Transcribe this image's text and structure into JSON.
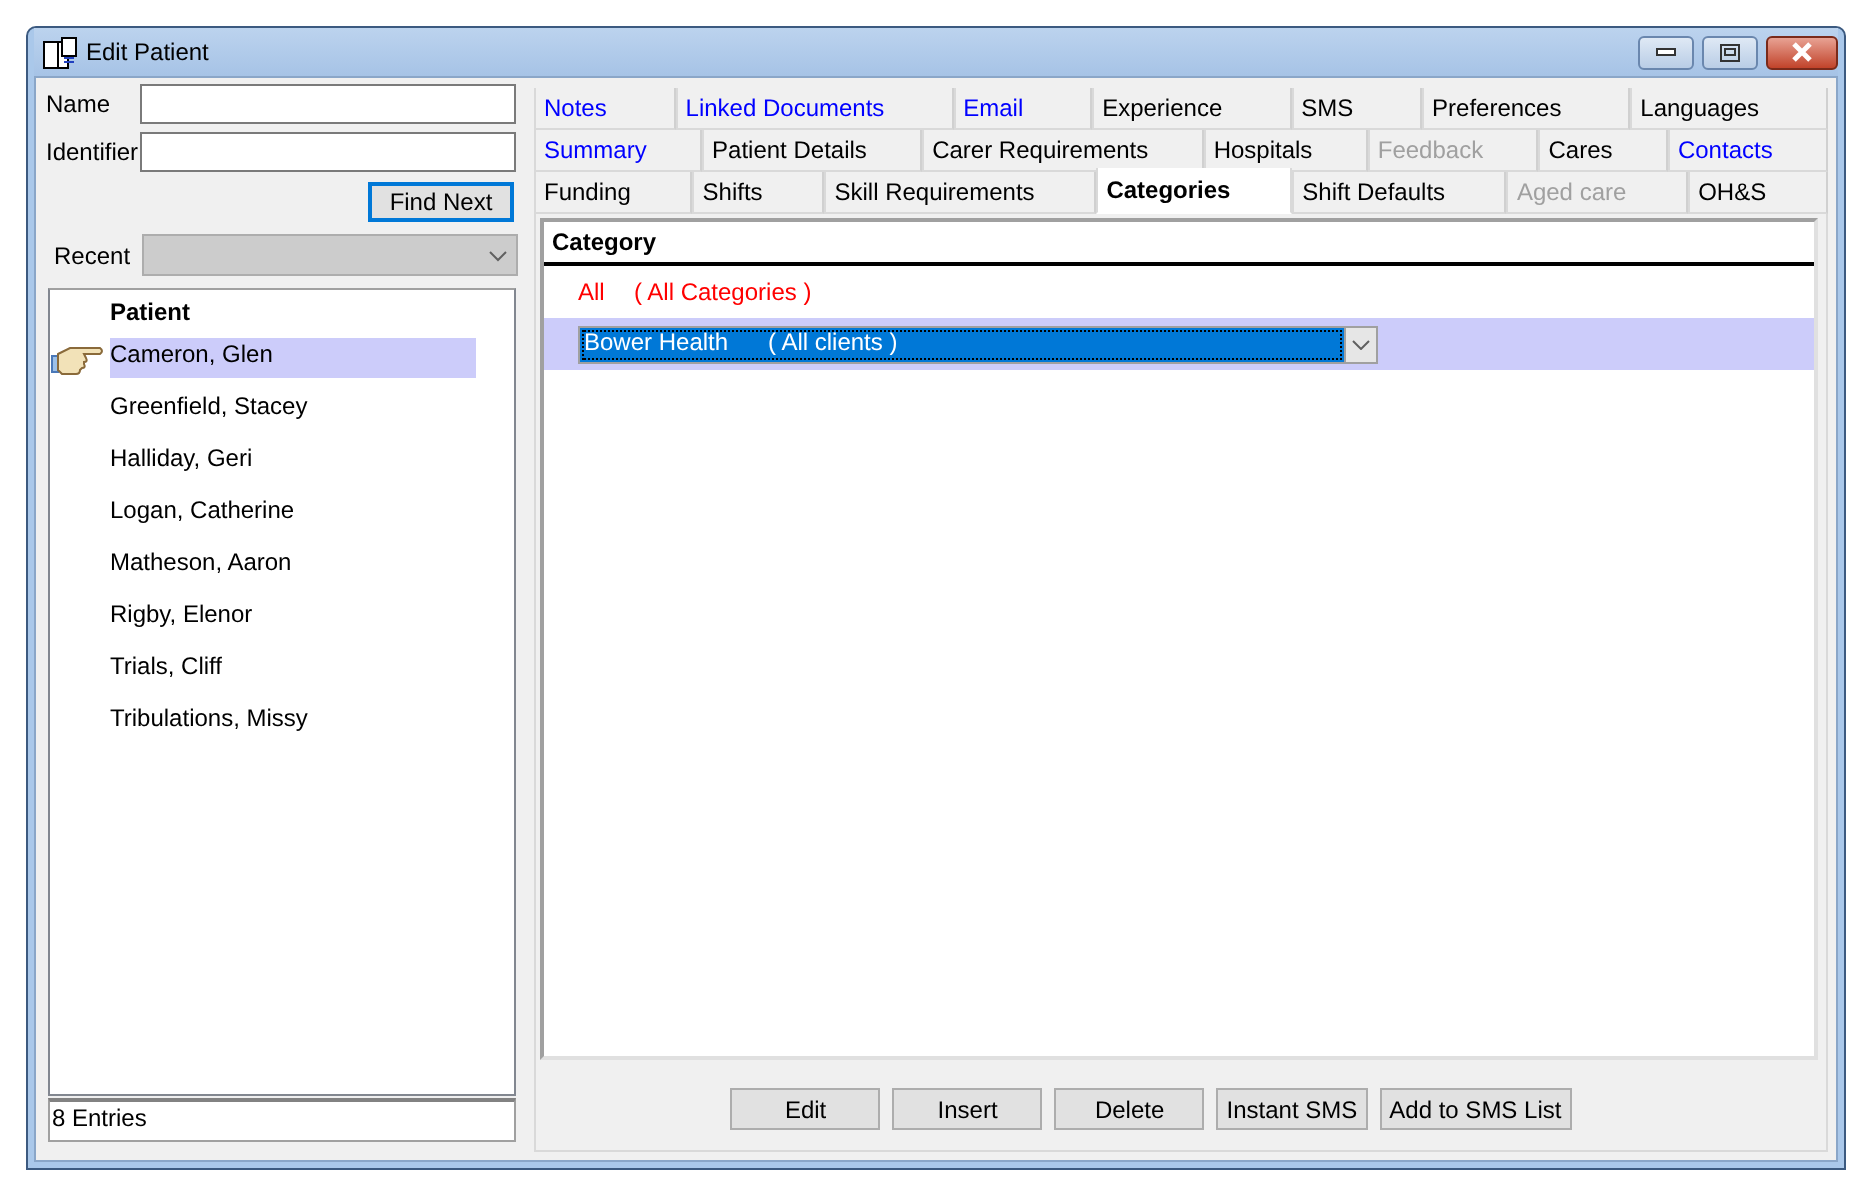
{
  "window": {
    "title": "Edit Patient"
  },
  "search": {
    "fields": [
      {
        "label": "Name"
      },
      {
        "label": "Identifier"
      }
    ],
    "find_button": "Find Next",
    "recent": {
      "label": "Recent",
      "disabled": true
    }
  },
  "patients": {
    "header": "Patient",
    "items": [
      {
        "name": "Cameron, Glen",
        "selected": true
      },
      {
        "name": "Greenfield, Stacey",
        "selected": false
      },
      {
        "name": "Halliday, Geri",
        "selected": false
      },
      {
        "name": "Logan, Catherine",
        "selected": false
      },
      {
        "name": "Matheson, Aaron",
        "selected": false
      },
      {
        "name": "Rigby, Elenor",
        "selected": false
      },
      {
        "name": "Trials, Cliff",
        "selected": false
      },
      {
        "name": "Tribulations, Missy",
        "selected": false
      }
    ],
    "status": "8 Entries"
  },
  "tab_rows": [
    [
      {
        "label": "Notes",
        "kind": "link",
        "disabled": false,
        "selected": false
      },
      {
        "label": "Linked Documents",
        "kind": "link",
        "disabled": false,
        "selected": false
      },
      {
        "label": "Email",
        "kind": "link",
        "disabled": false,
        "selected": false
      },
      {
        "label": "Experience",
        "kind": "plain",
        "disabled": false,
        "selected": false
      },
      {
        "label": "SMS",
        "kind": "plain",
        "disabled": false,
        "selected": false
      },
      {
        "label": "Preferences",
        "kind": "plain",
        "disabled": false,
        "selected": false
      },
      {
        "label": "Languages",
        "kind": "plain",
        "disabled": false,
        "selected": false
      }
    ],
    [
      {
        "label": "Summary",
        "kind": "link",
        "disabled": false,
        "selected": false
      },
      {
        "label": "Patient Details",
        "kind": "plain",
        "disabled": false,
        "selected": false
      },
      {
        "label": "Carer Requirements",
        "kind": "plain",
        "disabled": false,
        "selected": false
      },
      {
        "label": "Hospitals",
        "kind": "plain",
        "disabled": false,
        "selected": false
      },
      {
        "label": "Feedback",
        "kind": "plain",
        "disabled": true,
        "selected": false
      },
      {
        "label": "Cares",
        "kind": "plain",
        "disabled": false,
        "selected": false
      },
      {
        "label": "Contacts",
        "kind": "link",
        "disabled": false,
        "selected": false
      }
    ],
    [
      {
        "label": "Funding",
        "kind": "plain",
        "disabled": false,
        "selected": false
      },
      {
        "label": "Shifts",
        "kind": "plain",
        "disabled": false,
        "selected": false
      },
      {
        "label": "Skill Requirements",
        "kind": "plain",
        "disabled": false,
        "selected": false
      },
      {
        "label": "Categories",
        "kind": "plain",
        "disabled": false,
        "selected": true
      },
      {
        "label": "Shift Defaults",
        "kind": "plain",
        "disabled": false,
        "selected": false
      },
      {
        "label": "Aged care",
        "kind": "plain",
        "disabled": true,
        "selected": false
      },
      {
        "label": "OH&S",
        "kind": "plain",
        "disabled": false,
        "selected": false
      }
    ]
  ],
  "category_grid": {
    "header": "Category",
    "rows": [
      {
        "kind": "text",
        "name": "All",
        "detail": "( All Categories )",
        "selected": false
      },
      {
        "kind": "dropdown",
        "name": "Bower Health",
        "detail": "( All clients )",
        "selected": true
      }
    ]
  },
  "buttons": [
    "Edit",
    "Insert",
    "Delete",
    "Instant SMS",
    "Add to SMS List"
  ]
}
